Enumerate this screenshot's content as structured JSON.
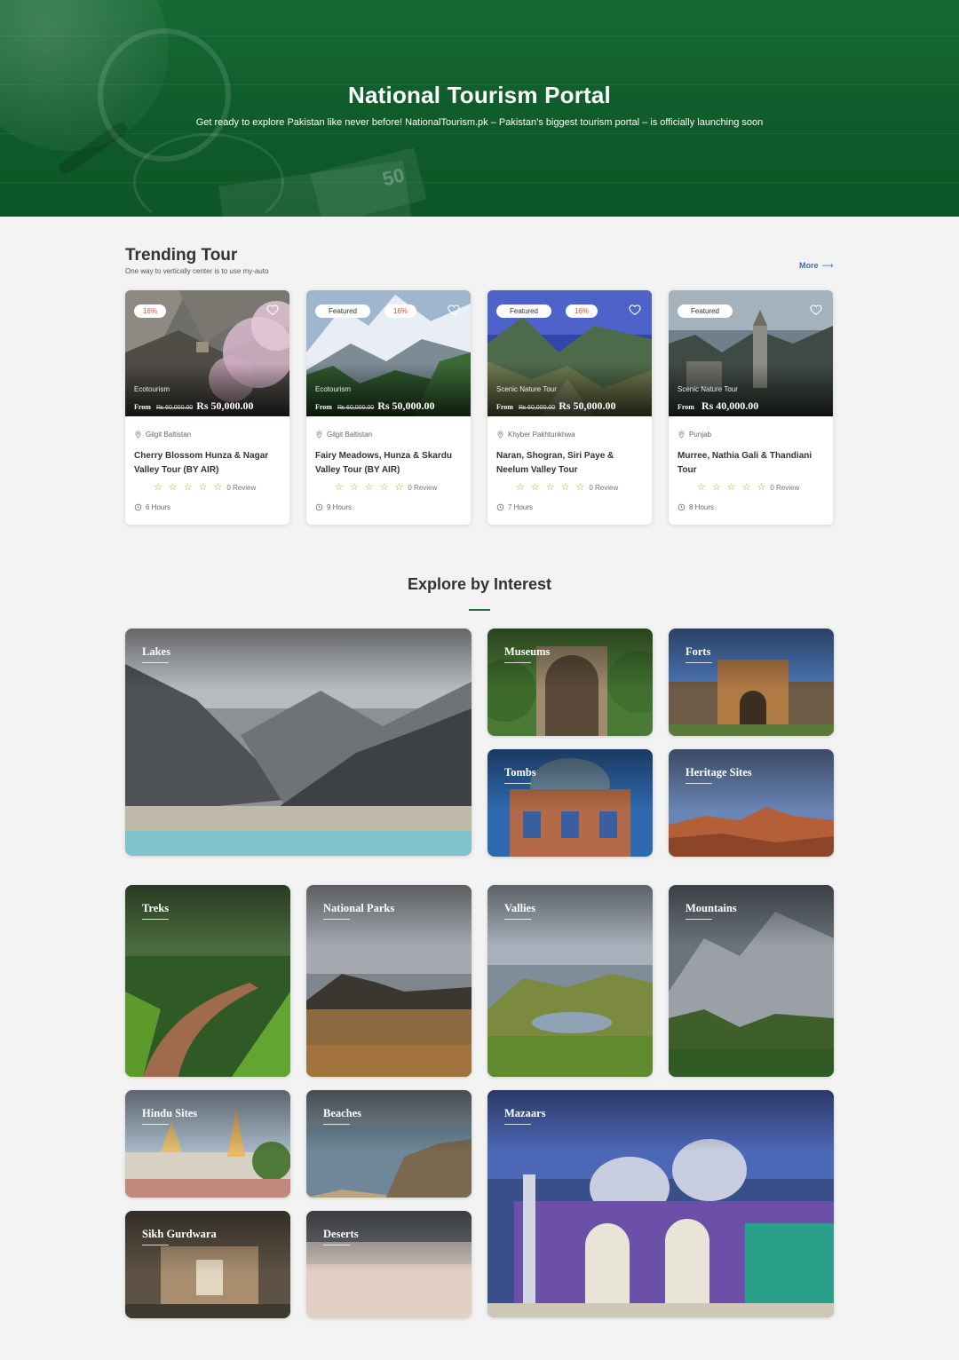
{
  "hero": {
    "title": "National Tourism Portal",
    "subtitle": "Get ready to explore Pakistan like never before! NationalTourism.pk – Pakistan’s biggest tourism portal – is officially launching soon",
    "money_text": "50"
  },
  "trending": {
    "title": "Trending Tour",
    "subtitle": "One way to vertically center is to use my-auto",
    "more_label": "More",
    "cards": [
      {
        "featured": "",
        "discount": "16%",
        "category": "Ecotourism",
        "from": "From",
        "old_price": "₨ 60,000.00",
        "price": "Rs 50,000.00",
        "location": "Gilgit Baltistan",
        "name": "Cherry Blossom Hunza & Nagar Valley Tour (BY AIR)",
        "reviews": "0 Review",
        "duration": "6 Hours"
      },
      {
        "featured": "Featured",
        "discount": "16%",
        "category": "Ecotourism",
        "from": "From",
        "old_price": "₨ 60,000.00",
        "price": "Rs 50,000.00",
        "location": "Gilgit Baltistan",
        "name": "Fairy Meadows, Hunza & Skardu Valley Tour (BY AIR)",
        "reviews": "0 Review",
        "duration": "9 Hours"
      },
      {
        "featured": "Featured",
        "discount": "16%",
        "category": "Scenic Nature Tour",
        "from": "From",
        "old_price": "₨ 60,000.00",
        "price": "Rs 50,000.00",
        "location": "Khyber Pakhtunkhwa",
        "name": "Naran, Shogran, Siri Paye & Neelum Valley Tour",
        "reviews": "0 Review",
        "duration": "7 Hours"
      },
      {
        "featured": "Featured",
        "discount": "",
        "category": "Scenic Nature Tour",
        "from": "From",
        "old_price": "",
        "price": "Rs 40,000.00",
        "location": "Punjab",
        "name": "Murree, Nathia Gali & Thandiani Tour",
        "reviews": "0 Review",
        "duration": "8 Hours"
      }
    ]
  },
  "explore": {
    "title": "Explore by Interest",
    "tiles": [
      "Lakes",
      "Museums",
      "Forts",
      "Tombs",
      "Heritage Sites",
      "Treks",
      "National Parks",
      "Vallies",
      "Mountains",
      "Hindu Sites",
      "Beaches",
      "Mazaars",
      "Sikh Gurdwara",
      "Deserts"
    ]
  },
  "colors": {
    "brand_green": "#0f5a2a",
    "star": "#9cb320",
    "discount": "#e04b3f",
    "link": "#3b6fb0"
  }
}
